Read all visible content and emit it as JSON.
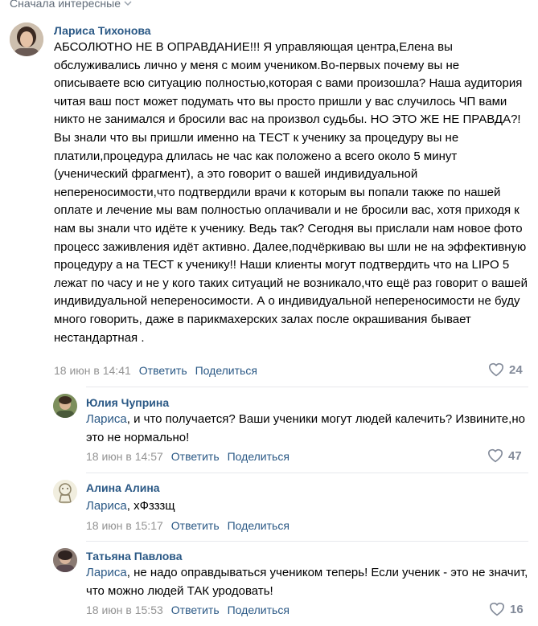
{
  "sort": {
    "label": "Сначала интересные",
    "icon": "chevron-down-icon"
  },
  "comments": [
    {
      "author": "Лариса Тихонова",
      "text": "АБСОЛЮТНО НЕ В ОПРАВДАНИЕ!!! Я управляющая центра,Елена вы обслуживались лично у меня с моим учеником.Во-первых почему вы не описываете всю ситуацию полностью,которая с вами произошла? Наша аудитория читая ваш пост может подумать что вы просто пришли у вас случилось ЧП вами никто не занимался и бросили вас на произвол судьбы. НО ЭТО ЖЕ НЕ ПРАВДА?! Вы знали что вы пришли именно на ТЕСТ к ученику за процедуру вы не платили,процедура длилась не час как положено а всего около 5 минут (ученический фрагмент), а это говорит о вашей индивидуальной непереносимости,что подтвердили врачи к которым вы попали также по нашей оплате и лечение мы вам полностью оплачивали и не бросили вас, хотя приходя к нам вы знали что идёте к ученику. Ведь так? Сегодня вы прислали нам новое фото процесс заживления идёт активно. Далее,подчёркиваю вы шли не на эффективную процедуру а на ТЕСТ к ученику!! Наши клиенты могут подтвердить что на LIPO 5 лежат по часу и не у кого таких ситуаций не возникало,что ещё раз говорит о вашей индивидуальной непереносимости. А о индивидуальной непереносимости не буду много говорить, даже в парикмахерских залах после окрашивания бывает нестандартная .",
      "date": "18 июн в 14:41",
      "reply": "Ответить",
      "share": "Поделиться",
      "likes": "24"
    },
    {
      "author": "Юлия Чуприна",
      "mention": "Лариса",
      "text": ", и что получается? Ваши ученики могут людей калечить? Извините,но это не нормально!",
      "date": "18 июн в 14:57",
      "reply": "Ответить",
      "share": "Поделиться",
      "likes": "47"
    },
    {
      "author": "Алина Алина",
      "mention": "Лариса",
      "text": ", хФзззщ",
      "date": "18 июн в 15:17",
      "reply": "Ответить",
      "share": "Поделиться"
    },
    {
      "author": "Татьяна Павлова",
      "mention": "Лариса",
      "text": ", не надо оправдываться учеником теперь! Если ученик - это не значит, что можно людей ТАК уродовать!",
      "date": "18 июн в 15:53",
      "reply": "Ответить",
      "share": "Поделиться",
      "likes": "16"
    }
  ],
  "colors": {
    "link": "#2a5885",
    "meta": "#939393",
    "like": "#828a99",
    "divider": "#e7e8ec"
  }
}
